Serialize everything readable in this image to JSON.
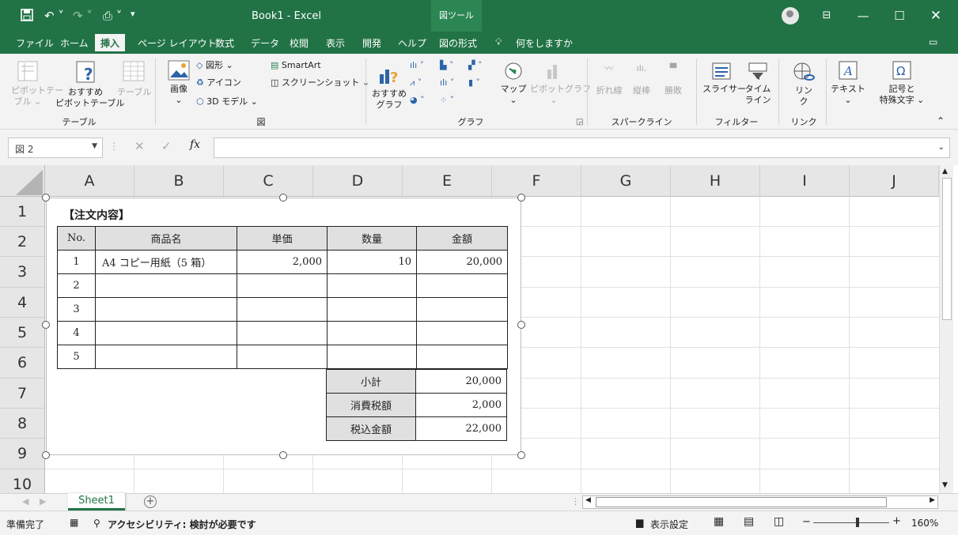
{
  "titlebar": {
    "save_icon": "save-icon",
    "title": "Book1  -  Excel",
    "tools_tab": "図ツール"
  },
  "menu": {
    "items": [
      "ファイル",
      "ホーム",
      "挿入",
      "ページ レイアウト",
      "数式",
      "データ",
      "校閲",
      "表示",
      "開発",
      "ヘルプ",
      "図の形式"
    ],
    "active": "挿入",
    "tell_me": "何をしますか"
  },
  "ribbon": {
    "pivot": "ピボットテーブル",
    "pivot_line1": "ピボットテー",
    "pivot_line2": "ブル ⌄",
    "rec_pivot_line1": "おすすめ",
    "rec_pivot_line2": "ピボットテーブル",
    "table": "テーブル",
    "group_table": "テーブル",
    "image": "画像",
    "shapes": "図形 ⌄",
    "icons": "アイコン",
    "models3d": "3D モデル  ⌄",
    "smartart": "SmartArt",
    "screenshot": "スクリーンショット ⌄",
    "group_illust": "図",
    "rec_chart_line1": "おすすめ",
    "rec_chart_line2": "グラフ",
    "map": "マップ",
    "pivot_chart": "ピボットグラフ",
    "group_chart": "グラフ",
    "spark_line": "折れ線",
    "spark_col": "縦棒",
    "spark_win": "勝敗",
    "group_spark": "スパークライン",
    "slicer": "スライサー",
    "timeline_line1": "タイム",
    "timeline_line2": "ライン",
    "group_filter": "フィルター",
    "link_line1": "リン",
    "link_line2": "ク",
    "group_link": "リンク",
    "text": "テキスト",
    "symbol_line1": "記号と",
    "symbol_line2": "特殊文字 ⌄"
  },
  "formula": {
    "namebox": "図 2",
    "fx": "fx"
  },
  "columns": [
    "A",
    "B",
    "C",
    "D",
    "E",
    "F",
    "G",
    "H",
    "I",
    "J"
  ],
  "rows": [
    "1",
    "2",
    "3",
    "4",
    "5",
    "6",
    "7",
    "8",
    "9",
    "10"
  ],
  "doc": {
    "title": "【注文内容】",
    "headers": [
      "No.",
      "商品名",
      "単価",
      "数量",
      "金額"
    ],
    "rows": [
      [
        "1",
        "A4 コピー用紙（5 箱）",
        "2,000",
        "10",
        "20,000"
      ],
      [
        "2",
        "",
        "",
        "",
        ""
      ],
      [
        "3",
        "",
        "",
        "",
        ""
      ],
      [
        "4",
        "",
        "",
        "",
        ""
      ],
      [
        "5",
        "",
        "",
        "",
        ""
      ]
    ],
    "summary": [
      [
        "小計",
        "20,000"
      ],
      [
        "消費税額",
        "2,000"
      ],
      [
        "税込金額",
        "22,000"
      ]
    ]
  },
  "sheet": {
    "tab": "Sheet1",
    "add": "+"
  },
  "status": {
    "ready": "準備完了",
    "accessibility": "アクセシビリティ: 検討が必要です",
    "display_settings": "表示設定",
    "zoom": "160%"
  }
}
